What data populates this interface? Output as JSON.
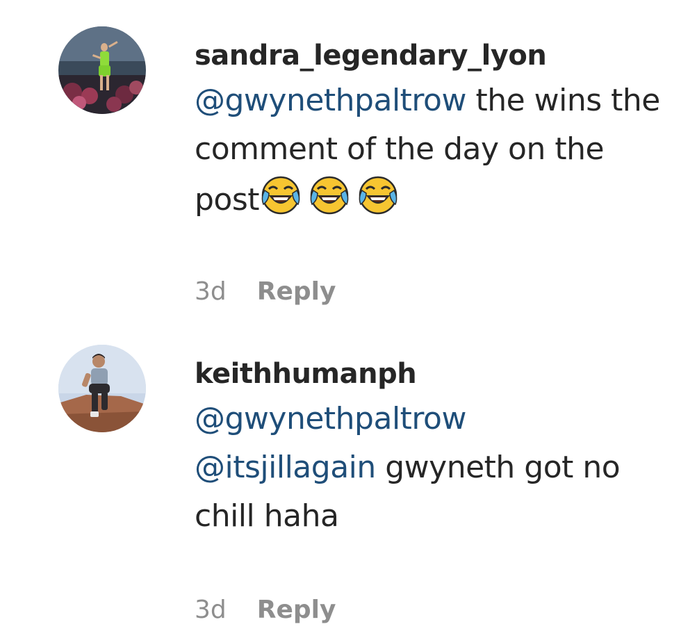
{
  "comments": [
    {
      "username": "sandra_legendary_lyon",
      "mention_1": "@gwynethpaltrow",
      "text_after": " the wins the comment of the day on the post",
      "emoji_icons": [
        "tears-of-joy-emoji-icon",
        "tears-of-joy-emoji-icon",
        "tears-of-joy-emoji-icon"
      ],
      "time": "3d",
      "reply_label": "Reply"
    },
    {
      "username": "keithhumanph",
      "mention_1": "@gwynethpaltrow",
      "mention_2": "@itsjillagain",
      "text_after": " gwyneth got no chill haha",
      "time": "3d",
      "reply_label": "Reply"
    }
  ],
  "colors": {
    "text": "#262626",
    "mention": "#1f4e79",
    "meta": "#8e8e8e"
  }
}
